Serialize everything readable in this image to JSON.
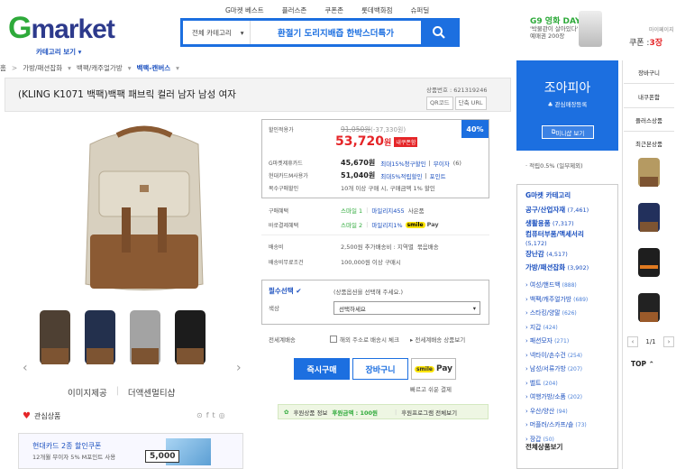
{
  "header": {
    "top_nav": [
      "G마켓 베스트",
      "플러스존",
      "쿠폰존",
      "롯데백화점",
      "슈퍼딜"
    ],
    "logo_g": "G",
    "logo_rest": "market",
    "category_view": "카테고리 보기 ▾",
    "search_category": "전체 카테고리",
    "search_query": "환절기 도리지배즙 한박스더특가",
    "promo_title": "G9 영화 DAY",
    "promo_line1": "'박물관이 살아있다'",
    "promo_line2": "예매권 200장",
    "mypage": "마이페이지",
    "coupon_label": "쿠폰 :",
    "coupon_count": "3장"
  },
  "breadcrumb": [
    "홈",
    "가방/패션잡화",
    "백팩/캐주얼가방",
    "백팩-캔버스"
  ],
  "product": {
    "title": "(KLING K1071 백팩)백팩 패브릭 컬러 남자 남성 여자",
    "code_label": "상품번호 : 621319246",
    "code_btn1": "QR코드",
    "code_btn2": "단축 URL",
    "img_provided": "이미지제공",
    "detail_link": "더액센멀티샵",
    "fav_label": "관심상품"
  },
  "price": {
    "sale_label": "할인적용가",
    "original": "91,050원",
    "discount": "(-37,330원)",
    "final": "53,720",
    "won": "원",
    "my_coupon": "내쿠폰함",
    "percent": "40%",
    "card_label": "G마켓제휴카드",
    "card_price": "45,670원",
    "card_desc": "최대15%청구할인",
    "card_free": "무이자",
    "card_months": "(6)",
    "hyundai_label": "현대카드M사용가",
    "hyundai_price": "51,040원",
    "hyundai_desc": "최대5%적립할인",
    "hyundai_point": "포인트",
    "multi_label": "복수구매할인",
    "multi_desc": "10개 이상 구매 시, 구매금액 1% 할인"
  },
  "benefits": {
    "buy_label": "구매혜택",
    "buy_smile": "스마일 1",
    "buy_mileage": "마일리지455",
    "buy_use": "사은품",
    "pay_label": "바로결제혜택",
    "pay_smile": "스마일 2",
    "pay_mileage": "마일리지1%",
    "pay_spay": "smile",
    "pay_spay_text": "Pay"
  },
  "shipping": {
    "fee_label": "배송비",
    "fee_desc": "2,500원 추가배송비 : 지역별",
    "fee_bundle": "묶음배송",
    "free_label": "배송비무료조건",
    "free_desc": "100,000원 이상 구매시"
  },
  "option": {
    "required_label": "필수선택",
    "required_hint": "(상품옵션을 선택해 주세요.)",
    "color_label": "색상",
    "select_placeholder": "선택하세요",
    "overseas_label": "전세계배송",
    "overseas_check": "해외 주소로 배송시 체크",
    "overseas_more": "전세계배송 상품보기"
  },
  "actions": {
    "buy_now": "즉시구매",
    "cart": "장바구니",
    "pay_smile": "smile",
    "pay_text": "Pay",
    "easy_pay": "빠르고 쉬운 결제",
    "sponsor_label": "후원상품 정보",
    "sponsor_amount": "후원금액 : 100원",
    "sponsor_program": "후원프로그램 전체보기"
  },
  "banner": {
    "title": "현대카드 2종 할인쿠폰",
    "desc": "12개월 무이자 5% M포인트 사용",
    "price": "5,000"
  },
  "seller": {
    "name": "조아피아",
    "fav": "관심매장등록",
    "mini": "미니샵 보기",
    "accumulate": "· 적립0.5% (일부제외)"
  },
  "category_panel": {
    "title": "G마켓 카테고리",
    "items": [
      {
        "name": "공구/산업자재",
        "count": "(7,461)"
      },
      {
        "name": "생활용품",
        "count": "(7,317)"
      },
      {
        "name": "컴퓨터부품/액세서리",
        "count": "(5,172)"
      },
      {
        "name": "장난감",
        "count": "(4,517)"
      },
      {
        "name": "가방/패션잡화",
        "count": "(3,902)"
      }
    ],
    "sub": [
      {
        "name": "여성/핸드백",
        "count": "(888)"
      },
      {
        "name": "백팩/캐주얼가방",
        "count": "(689)"
      },
      {
        "name": "스타킹/양말",
        "count": "(626)"
      },
      {
        "name": "지갑",
        "count": "(424)"
      },
      {
        "name": "패션모자",
        "count": "(271)"
      },
      {
        "name": "넥타이/손수건",
        "count": "(254)"
      },
      {
        "name": "남성/서류가방",
        "count": "(207)"
      },
      {
        "name": "벨트",
        "count": "(204)"
      },
      {
        "name": "여행가방/소품",
        "count": "(202)"
      },
      {
        "name": "우산/양산",
        "count": "(94)"
      },
      {
        "name": "머플러/스카프/숄",
        "count": "(73)"
      },
      {
        "name": "장갑",
        "count": "(50)"
      }
    ],
    "all": "전체상품보기"
  },
  "quick": {
    "items": [
      "장바구니",
      "내쿠폰함",
      "플러스상품",
      "최근본상품"
    ],
    "page": "1/1",
    "top": "TOP"
  }
}
